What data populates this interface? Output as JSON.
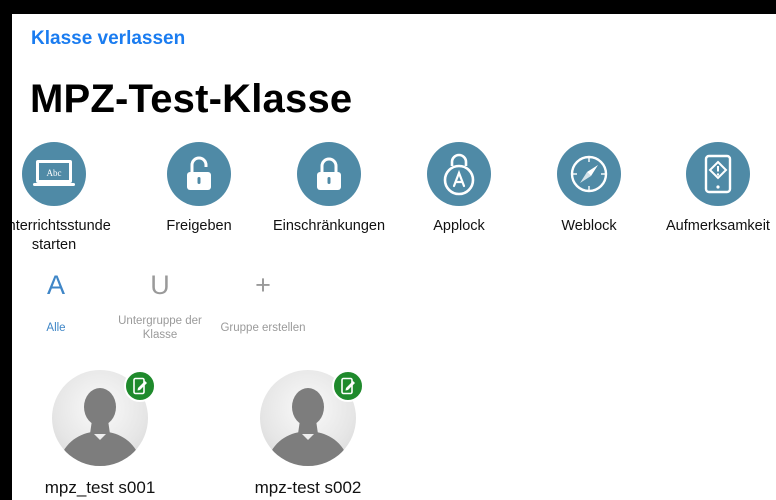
{
  "header": {
    "back_label": "Klasse verlassen",
    "title": "MPZ-Test-Klasse"
  },
  "actions": [
    {
      "label": "Unterrichtsstunde starten",
      "icon": "screen-abc-icon"
    },
    {
      "label": "Freigeben",
      "icon": "unlock-icon"
    },
    {
      "label": "Einschränkungen",
      "icon": "lock-icon"
    },
    {
      "label": "Applock",
      "icon": "app-lock-icon"
    },
    {
      "label": "Weblock",
      "icon": "compass-icon"
    },
    {
      "label": "Aufmerksamkeit",
      "icon": "tablet-alert-icon"
    }
  ],
  "groups": [
    {
      "glyph": "A",
      "label": "Alle",
      "active": true
    },
    {
      "glyph": "U",
      "label": "Untergruppe der Klasse",
      "active": false
    },
    {
      "glyph": "+",
      "label": "Gruppe erstellen",
      "active": false
    }
  ],
  "students": [
    {
      "name": "mpz_test s001",
      "badge": "device-edit-icon"
    },
    {
      "name": "mpz-test s002",
      "badge": "device-edit-icon"
    }
  ],
  "colors": {
    "accent_link": "#1a7cf0",
    "action_circle": "#4f8aa6",
    "group_active": "#3f86c7",
    "group_inactive": "#9a9a9a",
    "badge_green": "#1f8a2c"
  },
  "action_icons": {
    "screen_label": "Abc"
  }
}
